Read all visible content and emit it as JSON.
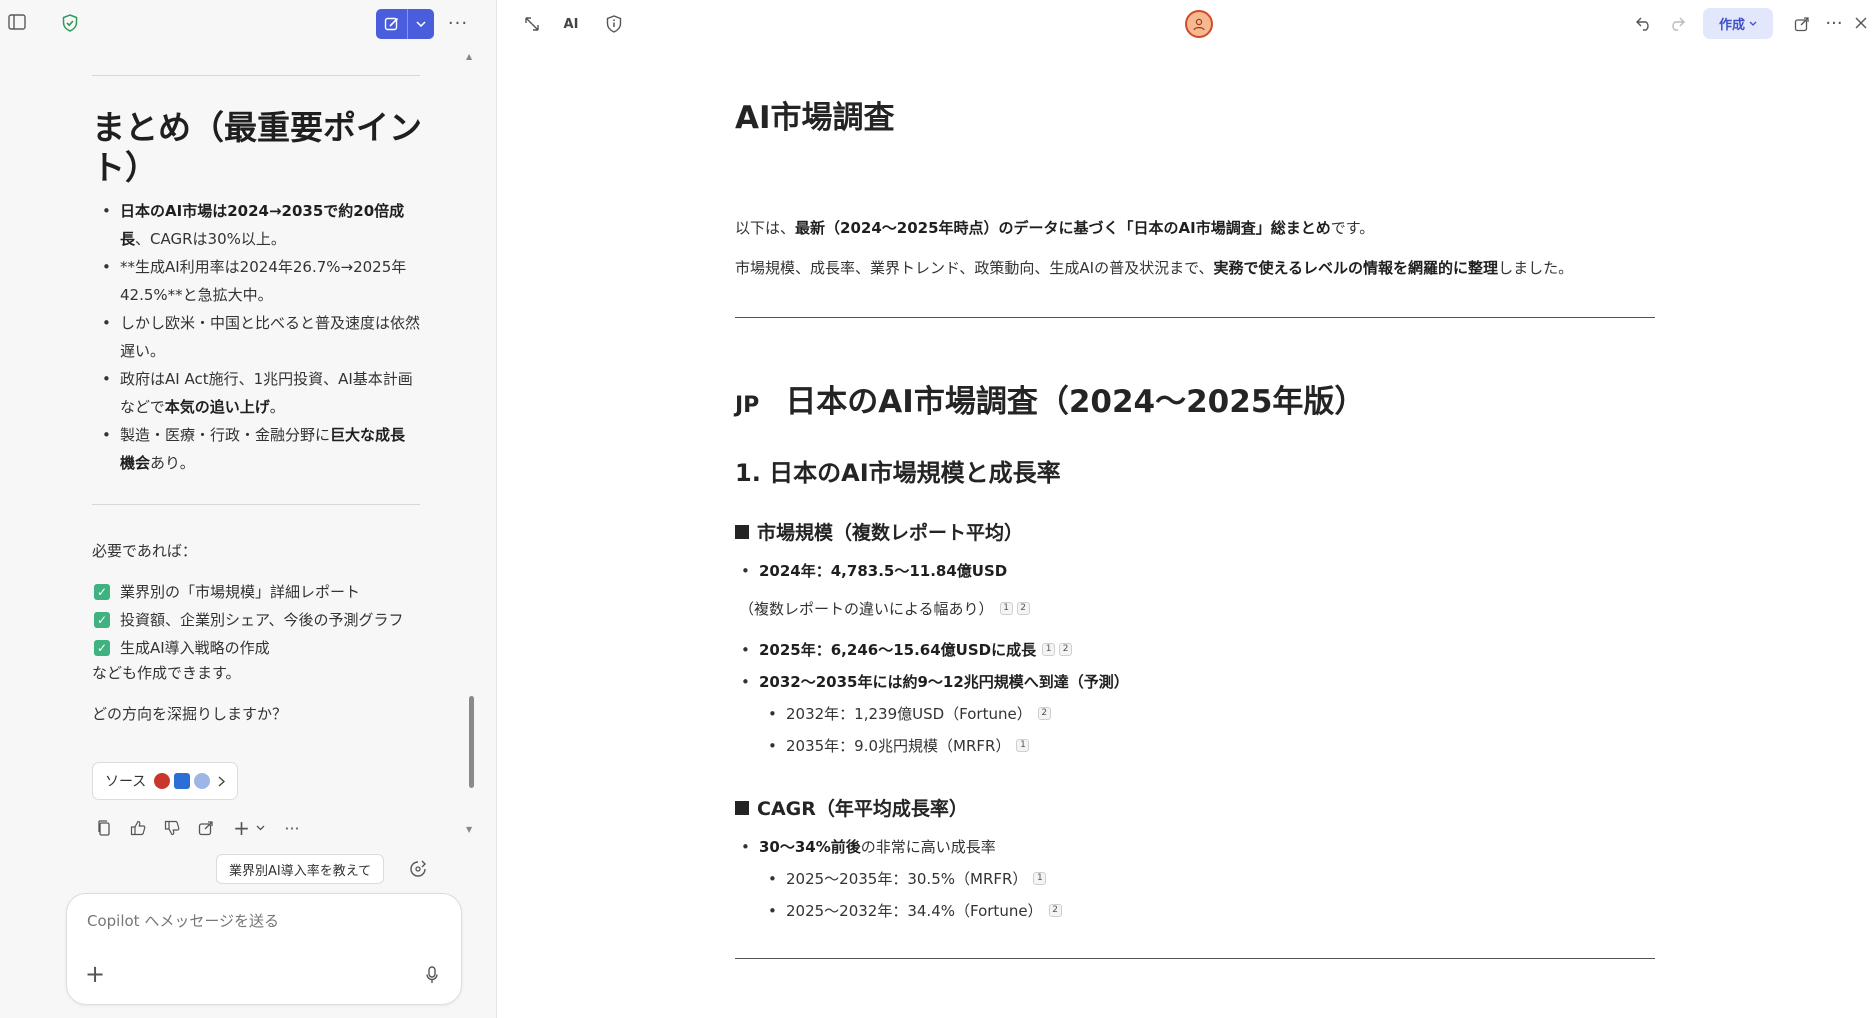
{
  "left_pane": {
    "summary_title": "まとめ（最重要ポイント）",
    "summary_items": [
      {
        "bold": "日本のAI市場は2024→2035で約20倍成長",
        "rest": "、CAGRは30%以上。",
        "bold2": "",
        "rest2": ""
      },
      {
        "bold": "",
        "rest": "**生成AI利用率は2024年26.7%→2025年42.5%**と急拡大中。",
        "bold2": "",
        "rest2": ""
      },
      {
        "bold": "",
        "rest": "しかし欧米・中国と比べると普及速度は依然遅い。",
        "bold2": "",
        "rest2": ""
      },
      {
        "bold": "",
        "rest": "政府はAI Act施行、1兆円投資、AI基本計画などで",
        "bold2": "本気の追い上げ",
        "rest2": "。"
      },
      {
        "bold": "",
        "rest": "製造・医療・行政・金融分野に",
        "bold2": "巨大な成長機会",
        "rest2": "あり。"
      }
    ],
    "intro": "必要であれば：",
    "options": [
      "業界別の「市場規模」詳細レポート",
      "投資額、企業別シェア、今後の予測グラフ",
      "生成AI導入戦略の作成"
    ],
    "also": "なども作成できます。",
    "question": "どの方向を深掘りしますか？",
    "sources_label": "ソース",
    "suggestion_chip": "業界別AI導入率を教えて",
    "composer_placeholder": "Copilot へメッセージを送る",
    "colors": {
      "accent": "#4a5ddd",
      "check": "#3fb27f"
    }
  },
  "doc": {
    "title": "AI市場調査",
    "intro_1": {
      "a": "以下は、",
      "b": "最新（2024〜2025年時点）のデータに基づく「日本のAI市場調査」総まとめ",
      "c": "です。"
    },
    "intro_2": {
      "a": "市場規模、成長率、業界トレンド、政策動向、生成AIの普及状況まで、",
      "b": "実務で使えるレベルの情報を網羅的に整理",
      "c": "しました。"
    },
    "h1_flag": "JP",
    "h1": "日本のAI市場調査（2024〜2025年版）",
    "h2": "1. 日本のAI市場規模と成長率",
    "section_market": {
      "title": "市場規模（複数レポート平均）",
      "item_2024": "2024年：4,783.5〜11.84億USD",
      "note": "（複数レポートの違いによる幅あり）",
      "note_cites": [
        "1",
        "2"
      ],
      "item_2025": "2025年：6,246〜15.64億USDに成長",
      "item_2025_cites": [
        "1",
        "2"
      ],
      "item_2032": "2032〜2035年には約9〜12兆円規模へ到達（予測）",
      "sub_2032": "2032年：1,239億USD（Fortune）",
      "sub_2032_cite": "2",
      "sub_2035": "2035年：9.0兆円規模（MRFR）",
      "sub_2035_cite": "1"
    },
    "section_cagr": {
      "title": "CAGR（年平均成長率）",
      "item_bold": "30〜34%前後",
      "item_rest": "の非常に高い成長率",
      "sub_1": "2025〜2035年：30.5%（MRFR）",
      "sub_1_cite": "1",
      "sub_2": "2025〜2032年：34.4%（Fortune）",
      "sub_2_cite": "2"
    }
  },
  "toolbar": {
    "ai_label": "AI",
    "create_label": "作成"
  }
}
